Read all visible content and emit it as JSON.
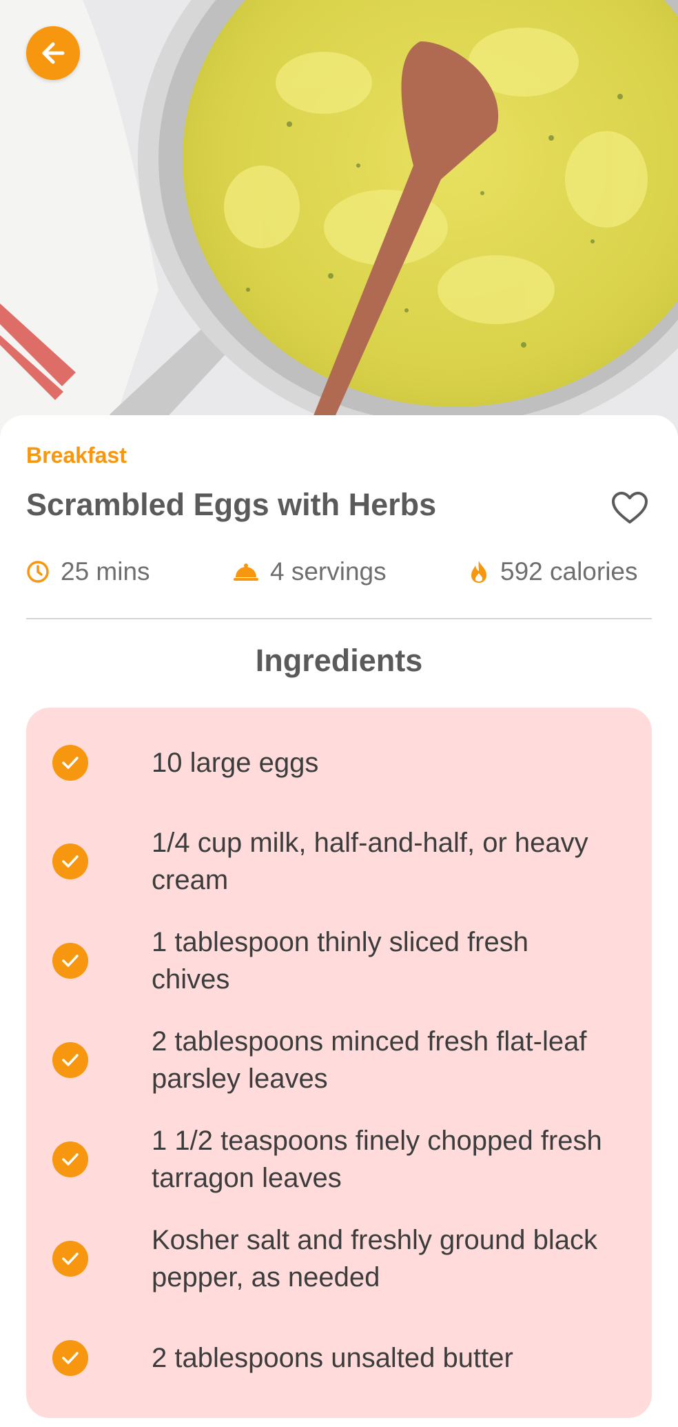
{
  "recipe": {
    "category": "Breakfast",
    "title": "Scrambled Eggs with Herbs",
    "time": "25 mins",
    "servings": "4 servings",
    "calories": "592 calories"
  },
  "ingredients": {
    "heading": "Ingredients",
    "items": [
      {
        "text": "10 large eggs",
        "checked": true
      },
      {
        "text": "1/4 cup milk, half-and-half, or heavy cream",
        "checked": true
      },
      {
        "text": "1 tablespoon thinly sliced fresh chives",
        "checked": true
      },
      {
        "text": "2 tablespoons minced fresh flat-leaf parsley leaves",
        "checked": true
      },
      {
        "text": "1 1/2 teaspoons finely chopped fresh tarragon leaves",
        "checked": true
      },
      {
        "text": "Kosher salt and freshly ground black pepper, as needed",
        "checked": true
      },
      {
        "text": "2 tablespoons unsalted butter",
        "checked": true
      }
    ]
  },
  "icons": {
    "back": "arrow-left-icon",
    "favorite": "heart-outline-icon",
    "time": "clock-icon",
    "servings": "cloche-icon",
    "calories": "flame-icon",
    "check": "check-icon"
  },
  "colors": {
    "accent": "#f7960f",
    "ingredients_background": "#ffdcdb",
    "title_text": "#5a5a5a"
  }
}
